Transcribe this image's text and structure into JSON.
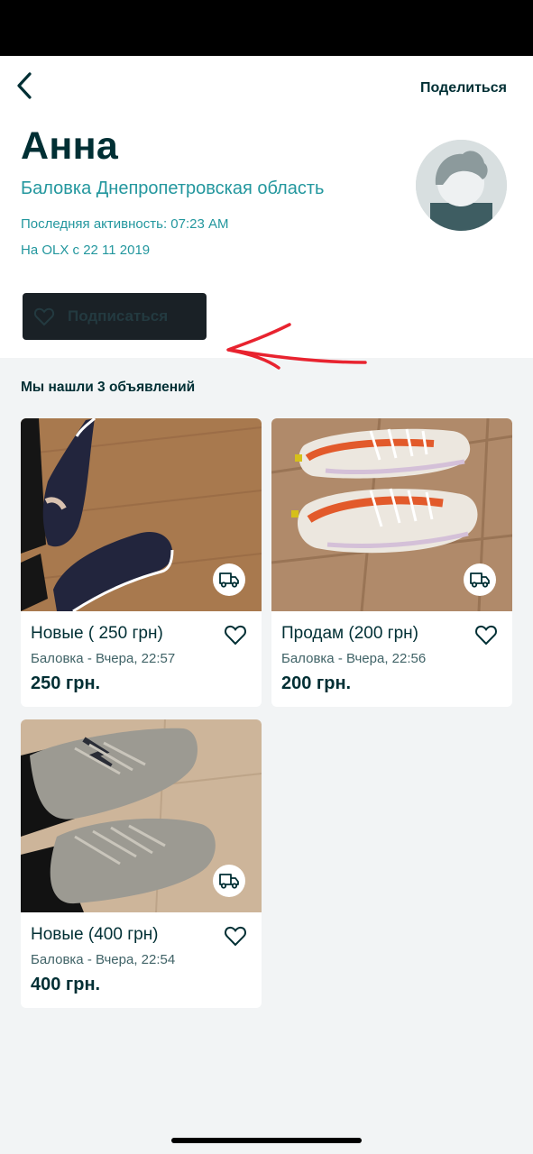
{
  "header": {
    "back_icon": "chevron-left-icon",
    "share_label": "Поделиться"
  },
  "profile": {
    "name": "Анна",
    "location": "Баловка Днепропетровская область",
    "last_activity": "Последняя активность: 07:23 AM",
    "member_since": "На OLX с 22 11 2019",
    "follow_label": "Подписаться",
    "follow_icon": "heart-outline-icon",
    "avatar_icon": "default-avatar-icon"
  },
  "results": {
    "title": "Мы нашли 3 объявлений"
  },
  "listings": [
    {
      "title": "Новые ( 250 грн)",
      "meta": "Баловка - Вчера, 22:57",
      "price": "250 грн.",
      "delivery_icon": "truck-icon",
      "photo": "dark blue knit slip-on sneakers on wooden floor"
    },
    {
      "title": "Продам (200 грн)",
      "meta": "Баловка - Вчера, 22:56",
      "price": "200 грн.",
      "delivery_icon": "truck-icon",
      "photo": "white-orange sneakers on tile floor"
    },
    {
      "title": "Новые (400 грн)",
      "meta": "Баловка - Вчера, 22:54",
      "price": "400 грн.",
      "delivery_icon": "truck-icon",
      "photo": "grey suede sneakers on beige tile"
    }
  ],
  "colors": {
    "brand_dark": "#002f34",
    "accent_teal": "#23979e",
    "follow_button_bg": "#1a2126",
    "annotation_red": "#e8232f"
  }
}
